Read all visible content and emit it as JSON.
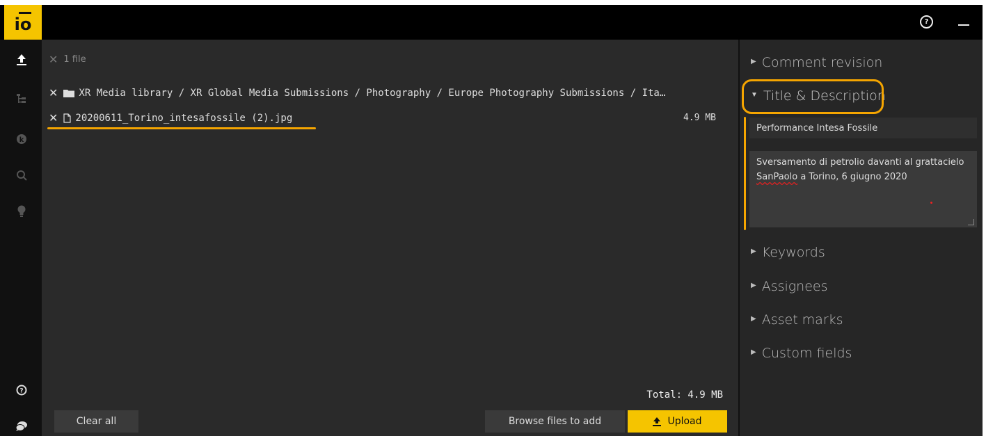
{
  "app": {
    "logo_text": "io"
  },
  "header": {
    "help_icon": "help-circle-icon",
    "minimize_icon": "minimize-icon"
  },
  "sidebar": {
    "items": [
      {
        "icon": "upload-icon",
        "active": true
      },
      {
        "icon": "tree-icon",
        "active": false
      },
      {
        "icon": "k-badge-icon",
        "active": false
      },
      {
        "icon": "search-icon",
        "active": false
      },
      {
        "icon": "lightbulb-icon",
        "active": false
      }
    ],
    "bottom": [
      {
        "icon": "help-circle-icon"
      },
      {
        "icon": "chat-icon"
      }
    ]
  },
  "files": {
    "count_label": "1 file",
    "folder_path": "XR Media library / XR Global Media Submissions / Photography / Europe Photography Submissions / Ita…",
    "file_name": "20200611_Torino_intesafossile (2).jpg",
    "file_size": "4.9 MB",
    "total_label": "Total: 4.9 MB"
  },
  "actions": {
    "clear_all": "Clear all",
    "browse": "Browse files to add",
    "upload": "Upload"
  },
  "panel": {
    "sections": {
      "comment_revision": "Comment revision",
      "title_description": "Title & Description",
      "keywords": "Keywords",
      "assignees": "Assignees",
      "asset_marks": "Asset marks",
      "custom_fields": "Custom fields"
    },
    "title_value": "Performance Intesa Fossile",
    "description_pre": "Sversamento di petrolio davanti al grattacielo ",
    "description_misspelled": "SanPaolo",
    "description_post": " a Torino, 6 giugno 2020"
  },
  "colors": {
    "accent": "#f5c400",
    "annotation": "#f5a500"
  }
}
